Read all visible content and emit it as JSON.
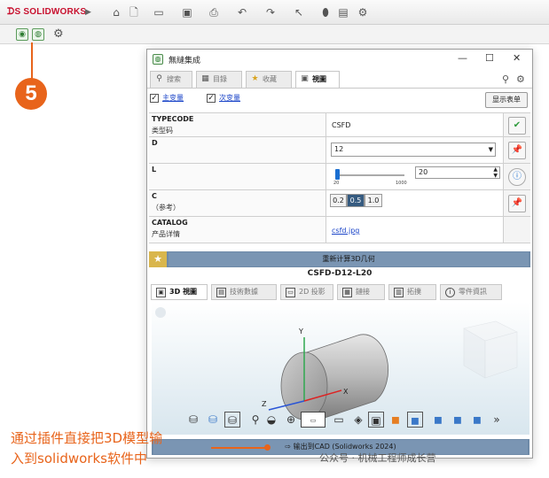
{
  "app": {
    "logo": "SOLIDWORKS"
  },
  "dialog": {
    "title": "無縫集成",
    "tabs": [
      {
        "label": "搜索",
        "icon": "search-icon"
      },
      {
        "label": "目錄",
        "icon": "catalog-icon"
      },
      {
        "label": "收藏",
        "icon": "star-icon"
      },
      {
        "label": "視圖",
        "icon": "view-icon",
        "active": true
      }
    ],
    "checkbox_main": {
      "label": "主变量",
      "checked": true
    },
    "checkbox_sub": {
      "label": "次变量",
      "checked": true
    },
    "show_form_button": "显示表单",
    "params": [
      {
        "key": "TYPECODE",
        "sub": "类型码",
        "value": "CSFD"
      },
      {
        "key": "D",
        "sub": "",
        "value": "12"
      },
      {
        "key": "L",
        "sub": "",
        "value": "20",
        "slider_min": "20",
        "slider_max": "1000"
      },
      {
        "key": "C",
        "sub": "（参考）",
        "options": [
          "0.2",
          "0.5",
          "1.0"
        ],
        "selected": "0.5"
      },
      {
        "key": "CATALOG",
        "sub": "产品详情",
        "value": "csfd.jpg"
      }
    ],
    "regen_label": "重新计算3D几何",
    "part_code": "CSFD-D12-L20",
    "view_tabs": [
      {
        "label": "3D 視圖",
        "active": true
      },
      {
        "label": "技術數據"
      },
      {
        "label": "2D 投影"
      },
      {
        "label": "鏈接"
      },
      {
        "label": "拓撲"
      },
      {
        "label": "零件資訊"
      }
    ],
    "axes": {
      "x": "X",
      "y": "Y",
      "z": "Z"
    },
    "export_label": "输出到CAD (Solidworks 2024)"
  },
  "callout": {
    "number": "5"
  },
  "annotation": {
    "line1": "通过插件直接把3D模型输",
    "line2": "入到solidworks软件中"
  },
  "watermark": "公众号 · 机械工程师成长营",
  "colors": {
    "accent": "#e8641b",
    "bar": "#6e8aa8",
    "sw_red": "#c8102e"
  }
}
